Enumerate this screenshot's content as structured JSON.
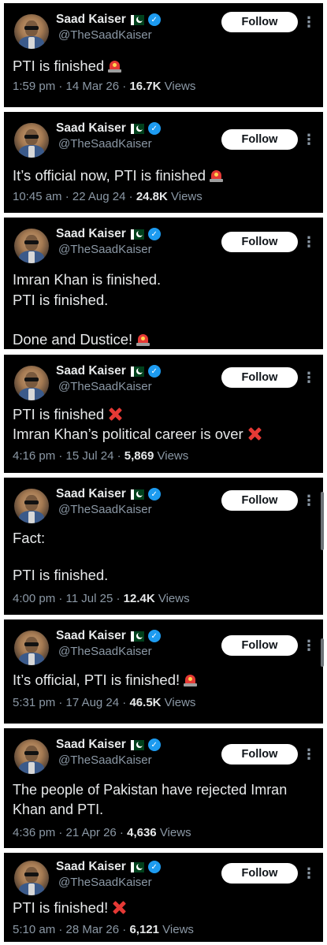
{
  "author": {
    "name": "Saad Kaiser",
    "handle": "@TheSaadKaiser",
    "follow_label": "Follow",
    "more_glyph": "⋮"
  },
  "tweets": [
    {
      "lines": [
        "PTI is finished"
      ],
      "emoji": "siren",
      "time": "1:59 pm",
      "date": "14 Mar 26",
      "views_count": "16.7K",
      "views_label": "Views"
    },
    {
      "lines": [
        "It’s official now, PTI is finished"
      ],
      "emoji": "siren",
      "time": "10:45 am",
      "date": "22 Aug 24",
      "views_count": "24.8K",
      "views_label": "Views"
    },
    {
      "lines": [
        "Imran Khan is finished.",
        "PTI is finished.",
        "",
        "Done and Dustice!"
      ],
      "emoji": "siren"
    },
    {
      "lines": [
        "PTI is finished",
        "Imran Khan’s political career is over"
      ],
      "emoji": "cross",
      "time": "4:16 pm",
      "date": "15 Jul 24",
      "views_count": "5,869",
      "views_label": "Views"
    },
    {
      "lines": [
        "Fact:",
        "",
        "PTI is finished."
      ],
      "emoji": "none",
      "time": "4:00 pm",
      "date": "11 Jul 25",
      "views_count": "12.4K",
      "views_label": "Views"
    },
    {
      "lines": [
        "It’s official, PTI is finished!"
      ],
      "emoji": "siren",
      "time": "5:31 pm",
      "date": "17 Aug 24",
      "views_count": "46.5K",
      "views_label": "Views"
    },
    {
      "lines": [
        "The people of Pakistan have rejected Imran",
        "Khan and PTI."
      ],
      "emoji": "none",
      "time": "4:36 pm",
      "date": "21 Apr 26",
      "views_count": "4,636",
      "views_label": "Views"
    },
    {
      "lines": [
        "PTI is finished!"
      ],
      "emoji": "cross",
      "time": "5:10 am",
      "date": "28 Mar 26",
      "views_count": "6,121",
      "views_label": "Views"
    }
  ],
  "separator": " · ",
  "colors": {
    "card_bg": "#000000",
    "text": "#e7e9ea",
    "muted": "#8b98a5",
    "verified_blue": "#1d9bf0",
    "follow_bg": "#ffffff",
    "flag_green": "#01411c",
    "emoji_red": "#e53935"
  },
  "icons": {
    "verified": "verified-badge-icon",
    "flag": "pakistan-flag-icon",
    "siren": "police-siren-emoji",
    "cross": "cross-mark-emoji",
    "more": "more-options-icon"
  }
}
